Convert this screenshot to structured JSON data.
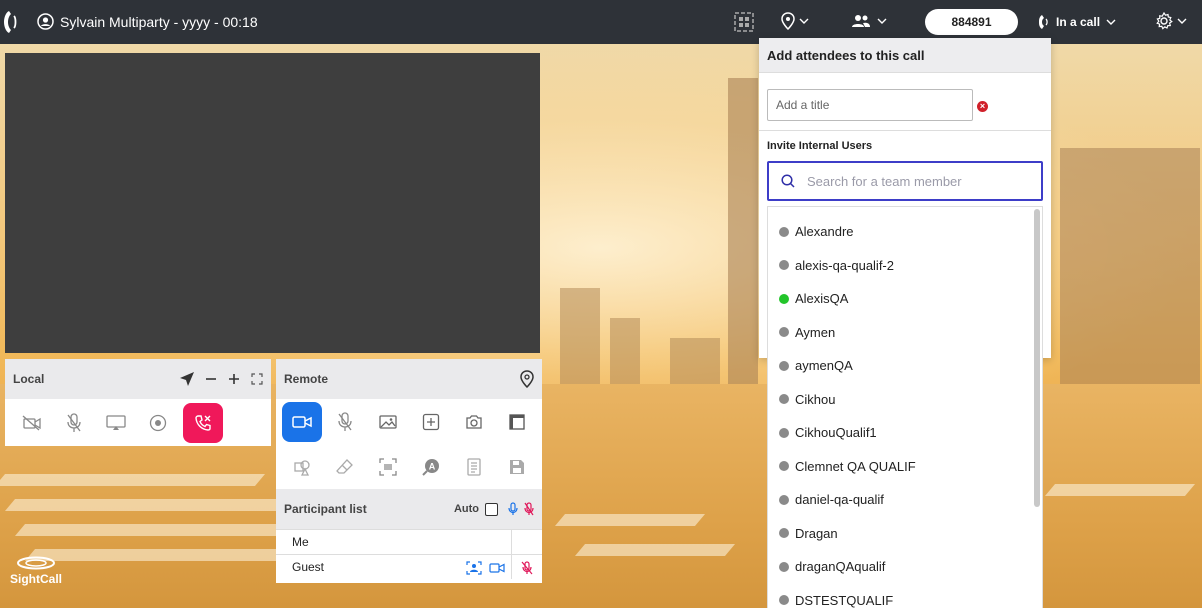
{
  "topbar": {
    "call_title": "Sylvain Multiparty - yyyy - 00:18",
    "code": "884891",
    "status": "In a call",
    "icons": [
      "phone-logo-icon",
      "user-circle-icon",
      "qr-code-icon",
      "location-icon",
      "participants-icon",
      "phone-icon",
      "gear-icon"
    ]
  },
  "local": {
    "label": "Local",
    "icons": [
      "location-arrow-icon",
      "zoom-out-icon",
      "zoom-in-icon",
      "fullscreen-icon",
      "camera-off-icon",
      "mic-off-icon",
      "screen-share-icon",
      "record-icon",
      "hangup-icon"
    ]
  },
  "remote": {
    "label": "Remote",
    "icons": [
      "location-pin-icon",
      "video-icon",
      "mic-off-icon",
      "gallery-icon",
      "add-icon",
      "camera-icon",
      "ruler-icon",
      "shapes-icon",
      "eraser-icon",
      "scan-icon",
      "ocr-icon",
      "notes-icon",
      "save-icon"
    ]
  },
  "participants": {
    "label": "Participant list",
    "auto_label": "Auto",
    "rows": [
      {
        "name": "Me"
      },
      {
        "name": "Guest"
      }
    ]
  },
  "attendees": {
    "title": "Add attendees to this call",
    "title_placeholder": "Add a title",
    "invite_label": "Invite Internal Users",
    "search_placeholder": "Search for a team member",
    "users": [
      {
        "name": "Alexandre",
        "status": "offline"
      },
      {
        "name": "alexis-qa-qualif-2",
        "status": "offline"
      },
      {
        "name": "AlexisQA",
        "status": "online"
      },
      {
        "name": "Aymen",
        "status": "offline"
      },
      {
        "name": "aymenQA",
        "status": "offline"
      },
      {
        "name": "Cikhou",
        "status": "offline"
      },
      {
        "name": "CikhouQualif1",
        "status": "offline"
      },
      {
        "name": "Clemnet QA QUALIF",
        "status": "offline"
      },
      {
        "name": "daniel-qa-qualif",
        "status": "offline"
      },
      {
        "name": "Dragan",
        "status": "offline"
      },
      {
        "name": "draganQAqualif",
        "status": "offline"
      },
      {
        "name": "DSTESTQUALIF",
        "status": "offline"
      }
    ]
  },
  "brand": {
    "name": "SightCall"
  },
  "colors": {
    "topbar": "#2e3238",
    "accent_blue": "#1a73e8",
    "hangup": "#f0185a",
    "online": "#23c52b",
    "offline": "#8a8a8a"
  }
}
